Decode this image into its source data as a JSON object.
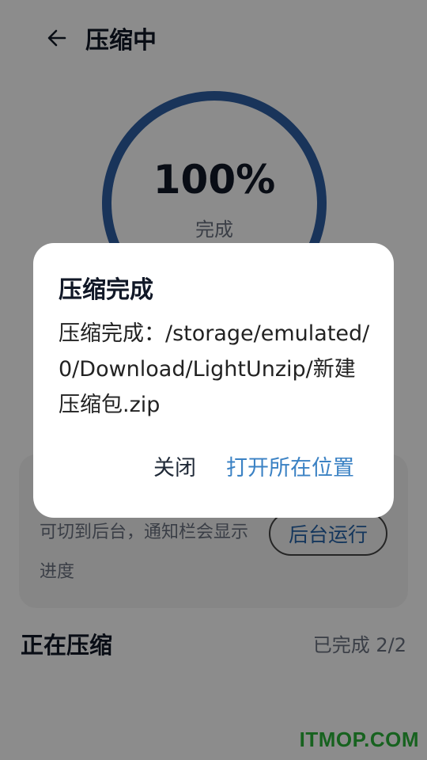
{
  "header": {
    "title": "压缩中"
  },
  "progress": {
    "percent_text": "100%",
    "status": "完成",
    "value": 1.0,
    "ring_color": "#2f5fa5"
  },
  "background_card": {
    "hint": "可切到后台，通知栏会显示进度",
    "button_label": "后台运行"
  },
  "section": {
    "title": "正在压缩",
    "count": "已完成 2/2"
  },
  "dialog": {
    "title": "压缩完成",
    "message": "压缩完成：/storage/emulated/0/Download/LightUnzip/新建压缩包.zip",
    "close_label": "关闭",
    "open_label": "打开所在位置"
  },
  "watermark": "ITMOP.COM",
  "colors": {
    "accent": "#3b82c4",
    "watermark": "#2bb33a"
  }
}
